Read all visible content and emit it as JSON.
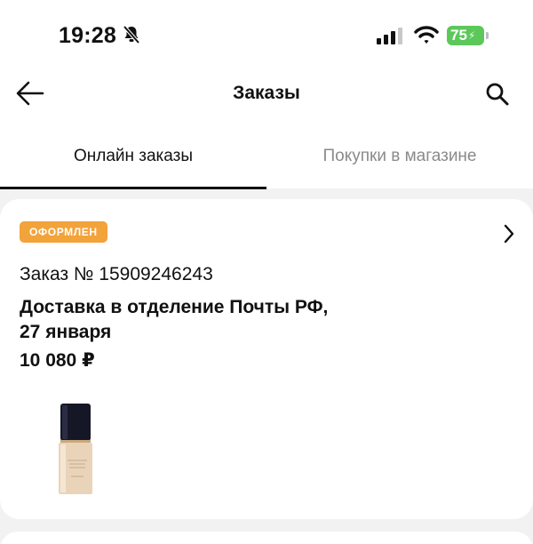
{
  "status_bar": {
    "time": "19:28",
    "battery": "75",
    "icons": [
      "bell-slash-icon",
      "signal-icon",
      "wifi-icon",
      "battery-icon"
    ]
  },
  "header": {
    "title": "Заказы",
    "icons": [
      "arrow-left-icon",
      "search-icon"
    ]
  },
  "tabs": [
    {
      "label": "Онлайн заказы",
      "active": true
    },
    {
      "label": "Покупки в магазине",
      "active": false
    }
  ],
  "orders": [
    {
      "status": "ОФОРМЛЕН",
      "status_color": "#f2a33a",
      "number": "Заказ № 15909246243",
      "delivery_line1": "Доставка в отделение Почты РФ,",
      "delivery_line2": "27 января",
      "price": "10 080 ₽",
      "product_image": "foundation-bottle"
    }
  ],
  "colors": {
    "background": "#f2f2f2",
    "battery": "#5cc85a",
    "inactive_tab": "#8a8a8a"
  }
}
